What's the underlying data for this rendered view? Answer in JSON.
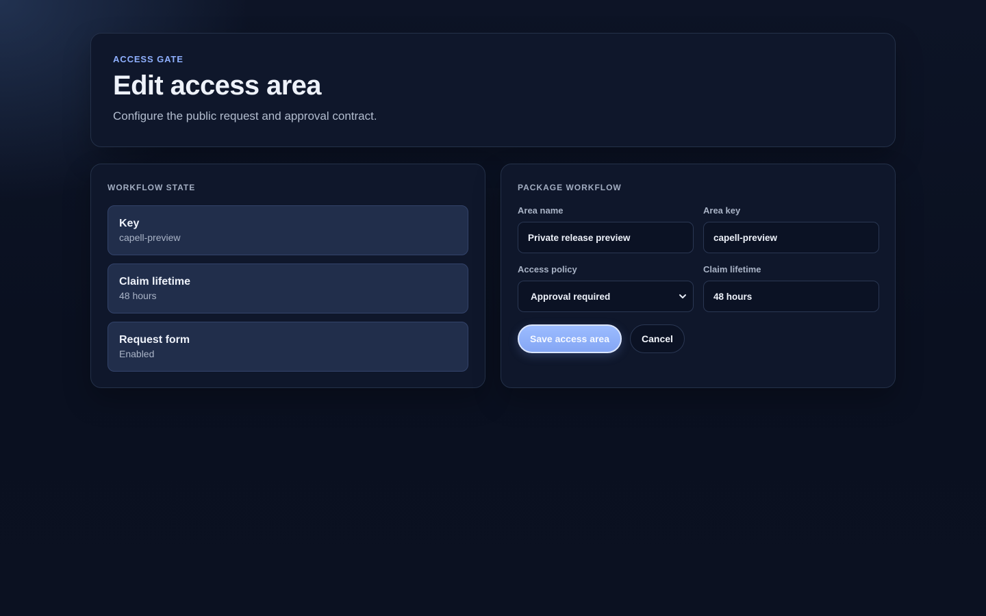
{
  "header": {
    "eyebrow": "ACCESS GATE",
    "title": "Edit access area",
    "subtitle": "Configure the public request and approval contract."
  },
  "workflow_state": {
    "title": "WORKFLOW STATE",
    "items": [
      {
        "label": "Key",
        "value": "capell-preview"
      },
      {
        "label": "Claim lifetime",
        "value": "48 hours"
      },
      {
        "label": "Request form",
        "value": "Enabled"
      }
    ]
  },
  "package_workflow": {
    "title": "PACKAGE WORKFLOW",
    "fields": {
      "area_name": {
        "label": "Area name",
        "value": "Private release preview"
      },
      "area_key": {
        "label": "Area key",
        "value": "capell-preview"
      },
      "access_policy": {
        "label": "Access policy",
        "value": "Approval required"
      },
      "claim_lifetime": {
        "label": "Claim lifetime",
        "value": "48 hours"
      }
    },
    "save_label": "Save access area",
    "cancel_label": "Cancel"
  },
  "colors": {
    "accent": "#8fb0ff",
    "primary_button": "#93b4fb",
    "panel_bg": "#0f172b",
    "item_bg": "#212e4b"
  },
  "icons": {
    "select_chevron": "chevron-down-icon"
  }
}
